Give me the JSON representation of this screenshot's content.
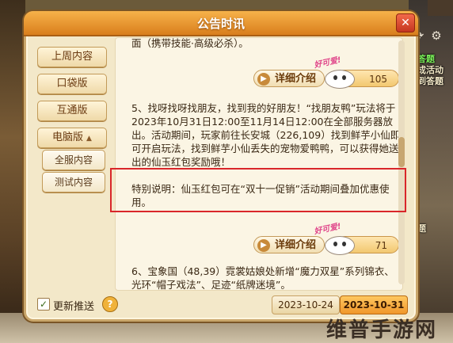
{
  "window": {
    "title": "公告时讯",
    "close": "✕"
  },
  "nav": {
    "items": [
      "上周内容",
      "口袋版",
      "互通版"
    ],
    "expanded": {
      "label": "电脑版",
      "arrow": "▲"
    },
    "sub_items": [
      "全服内容",
      "测试内容"
    ]
  },
  "posts": [
    {
      "text": "面（携带技能·高级必杀）。",
      "detail_label": "详细介绍",
      "likes": "105",
      "bubble": "好可爱!"
    },
    {
      "text": "5、找呀找呀找朋友，找到我的好朋友！“找朋友鸭”玩法将于2023年10月31日12:00至11月14日12:00在全部服务器放出。活动期间，玩家前往长安城（226,109）找到鲜芋小仙即可开启玩法，找到鲜芋小仙丢失的宠物爱鸭鸭，可以获得她送出的仙玉红包奖励哦！",
      "note": "特别说明：仙玉红包可在“双十一促销”活动期间叠加优惠使用。",
      "detail_label": "详细介绍",
      "likes": "71",
      "bubble": "好可爱!"
    },
    {
      "text": "6、宝象国（48,39）霓裳姑娘处新增“魔力双星”系列锦衣、光环“帽子戏法”、足迹“纸牌迷境”。"
    }
  ],
  "footer": {
    "checkbox_label": "更新推送",
    "checked": "✓",
    "help": "?",
    "dates": [
      "2023-10-24",
      "2023-10-31"
    ],
    "active_date": "2023-10-31"
  },
  "game_ui": {
    "lines": [
      "引答题",
      "完成活动",
      "签到答题",
      "显题"
    ]
  },
  "watermark": "维普手游网",
  "colors": {
    "accent": "#e8891f",
    "highlight_box": "#d9262a"
  }
}
